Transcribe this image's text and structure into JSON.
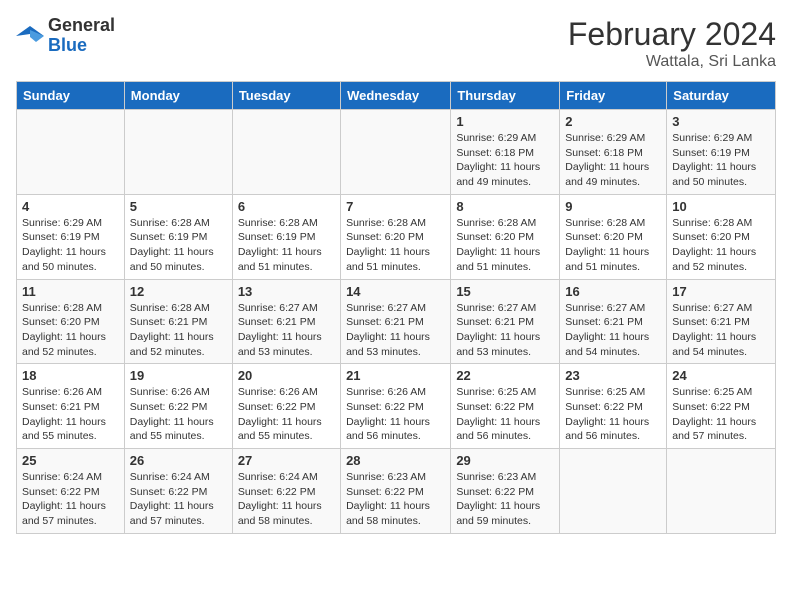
{
  "header": {
    "logo_general": "General",
    "logo_blue": "Blue",
    "title": "February 2024",
    "subtitle": "Wattala, Sri Lanka"
  },
  "days_of_week": [
    "Sunday",
    "Monday",
    "Tuesday",
    "Wednesday",
    "Thursday",
    "Friday",
    "Saturday"
  ],
  "weeks": [
    [
      {
        "day": "",
        "info": ""
      },
      {
        "day": "",
        "info": ""
      },
      {
        "day": "",
        "info": ""
      },
      {
        "day": "",
        "info": ""
      },
      {
        "day": "1",
        "info": "Sunrise: 6:29 AM\nSunset: 6:18 PM\nDaylight: 11 hours and 49 minutes."
      },
      {
        "day": "2",
        "info": "Sunrise: 6:29 AM\nSunset: 6:18 PM\nDaylight: 11 hours and 49 minutes."
      },
      {
        "day": "3",
        "info": "Sunrise: 6:29 AM\nSunset: 6:19 PM\nDaylight: 11 hours and 50 minutes."
      }
    ],
    [
      {
        "day": "4",
        "info": "Sunrise: 6:29 AM\nSunset: 6:19 PM\nDaylight: 11 hours and 50 minutes."
      },
      {
        "day": "5",
        "info": "Sunrise: 6:28 AM\nSunset: 6:19 PM\nDaylight: 11 hours and 50 minutes."
      },
      {
        "day": "6",
        "info": "Sunrise: 6:28 AM\nSunset: 6:19 PM\nDaylight: 11 hours and 51 minutes."
      },
      {
        "day": "7",
        "info": "Sunrise: 6:28 AM\nSunset: 6:20 PM\nDaylight: 11 hours and 51 minutes."
      },
      {
        "day": "8",
        "info": "Sunrise: 6:28 AM\nSunset: 6:20 PM\nDaylight: 11 hours and 51 minutes."
      },
      {
        "day": "9",
        "info": "Sunrise: 6:28 AM\nSunset: 6:20 PM\nDaylight: 11 hours and 51 minutes."
      },
      {
        "day": "10",
        "info": "Sunrise: 6:28 AM\nSunset: 6:20 PM\nDaylight: 11 hours and 52 minutes."
      }
    ],
    [
      {
        "day": "11",
        "info": "Sunrise: 6:28 AM\nSunset: 6:20 PM\nDaylight: 11 hours and 52 minutes."
      },
      {
        "day": "12",
        "info": "Sunrise: 6:28 AM\nSunset: 6:21 PM\nDaylight: 11 hours and 52 minutes."
      },
      {
        "day": "13",
        "info": "Sunrise: 6:27 AM\nSunset: 6:21 PM\nDaylight: 11 hours and 53 minutes."
      },
      {
        "day": "14",
        "info": "Sunrise: 6:27 AM\nSunset: 6:21 PM\nDaylight: 11 hours and 53 minutes."
      },
      {
        "day": "15",
        "info": "Sunrise: 6:27 AM\nSunset: 6:21 PM\nDaylight: 11 hours and 53 minutes."
      },
      {
        "day": "16",
        "info": "Sunrise: 6:27 AM\nSunset: 6:21 PM\nDaylight: 11 hours and 54 minutes."
      },
      {
        "day": "17",
        "info": "Sunrise: 6:27 AM\nSunset: 6:21 PM\nDaylight: 11 hours and 54 minutes."
      }
    ],
    [
      {
        "day": "18",
        "info": "Sunrise: 6:26 AM\nSunset: 6:21 PM\nDaylight: 11 hours and 55 minutes."
      },
      {
        "day": "19",
        "info": "Sunrise: 6:26 AM\nSunset: 6:22 PM\nDaylight: 11 hours and 55 minutes."
      },
      {
        "day": "20",
        "info": "Sunrise: 6:26 AM\nSunset: 6:22 PM\nDaylight: 11 hours and 55 minutes."
      },
      {
        "day": "21",
        "info": "Sunrise: 6:26 AM\nSunset: 6:22 PM\nDaylight: 11 hours and 56 minutes."
      },
      {
        "day": "22",
        "info": "Sunrise: 6:25 AM\nSunset: 6:22 PM\nDaylight: 11 hours and 56 minutes."
      },
      {
        "day": "23",
        "info": "Sunrise: 6:25 AM\nSunset: 6:22 PM\nDaylight: 11 hours and 56 minutes."
      },
      {
        "day": "24",
        "info": "Sunrise: 6:25 AM\nSunset: 6:22 PM\nDaylight: 11 hours and 57 minutes."
      }
    ],
    [
      {
        "day": "25",
        "info": "Sunrise: 6:24 AM\nSunset: 6:22 PM\nDaylight: 11 hours and 57 minutes."
      },
      {
        "day": "26",
        "info": "Sunrise: 6:24 AM\nSunset: 6:22 PM\nDaylight: 11 hours and 57 minutes."
      },
      {
        "day": "27",
        "info": "Sunrise: 6:24 AM\nSunset: 6:22 PM\nDaylight: 11 hours and 58 minutes."
      },
      {
        "day": "28",
        "info": "Sunrise: 6:23 AM\nSunset: 6:22 PM\nDaylight: 11 hours and 58 minutes."
      },
      {
        "day": "29",
        "info": "Sunrise: 6:23 AM\nSunset: 6:22 PM\nDaylight: 11 hours and 59 minutes."
      },
      {
        "day": "",
        "info": ""
      },
      {
        "day": "",
        "info": ""
      }
    ]
  ]
}
